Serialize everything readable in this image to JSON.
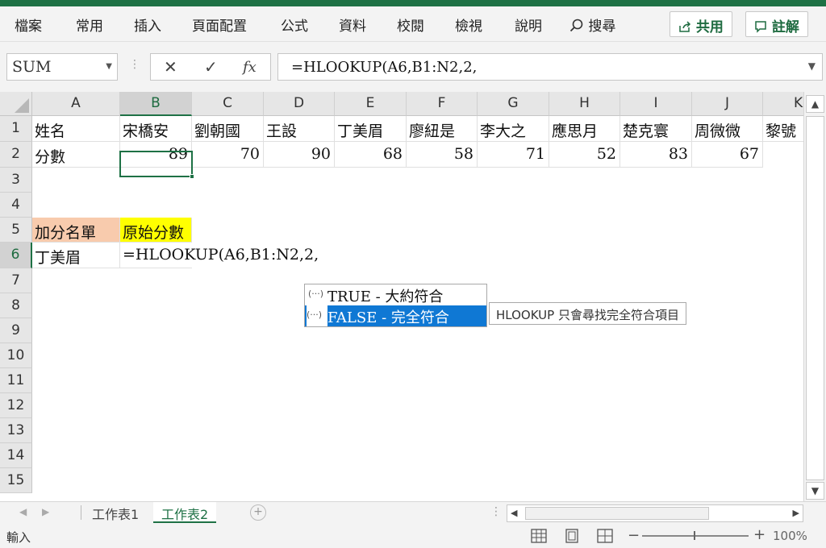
{
  "ribbon": {
    "tabs": [
      "檔案",
      "常用",
      "插入",
      "頁面配置",
      "公式",
      "資料",
      "校閱",
      "檢視",
      "說明"
    ],
    "search_label": "搜尋",
    "share_label": "共用",
    "comment_label": "註解"
  },
  "formula_bar": {
    "name_box": "SUM",
    "cancel_icon": "✕",
    "enter_icon": "✓",
    "fx_label": "fx",
    "formula": "=HLOOKUP(A6,B1:N2,2,"
  },
  "columns": [
    "A",
    "B",
    "C",
    "D",
    "E",
    "F",
    "G",
    "H",
    "I",
    "J",
    "K"
  ],
  "rows": [
    "1",
    "2",
    "3",
    "4",
    "5",
    "6",
    "7",
    "8",
    "9",
    "10",
    "11",
    "12",
    "13",
    "14",
    "15"
  ],
  "cells": {
    "row1": [
      "姓名",
      "宋橋安",
      "劉朝國",
      "王設",
      "丁美眉",
      "廖紐是",
      "李大之",
      "應思月",
      "楚克寰",
      "周微微",
      "黎號"
    ],
    "row2_label": "分數",
    "row2_values": [
      "89",
      "70",
      "90",
      "68",
      "58",
      "71",
      "52",
      "83",
      "67"
    ],
    "a5": "加分名單",
    "b5": "原始分數",
    "a6": "丁美眉",
    "b6": "=HLOOKUP(A6,B1:N2,2,"
  },
  "autocomplete": {
    "items": [
      {
        "icon": "(···)",
        "label": "TRUE - 大約符合"
      },
      {
        "icon": "(···)",
        "label": "FALSE - 完全符合"
      }
    ],
    "tooltip": "HLOOKUP 只會尋找完全符合項目"
  },
  "sheets": {
    "tabs": [
      "工作表1",
      "工作表2"
    ],
    "add_label": "+"
  },
  "status": {
    "mode": "輸入",
    "zoom": "100%"
  },
  "colors": {
    "brand": "#1e7145",
    "highlight_orange": "#f8cbad",
    "highlight_yellow": "#ffff00",
    "selection_blue": "#0f78d4"
  }
}
